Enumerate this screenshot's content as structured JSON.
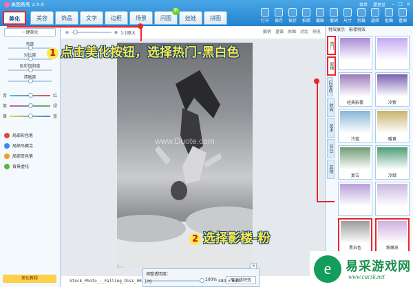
{
  "app": {
    "title": "美图秀秀 2.5.5"
  },
  "tabs": [
    {
      "label": "美化",
      "active": true
    },
    {
      "label": "美容"
    },
    {
      "label": "饰品"
    },
    {
      "label": "文字"
    },
    {
      "label": "边框"
    },
    {
      "label": "场景"
    },
    {
      "label": "闪图",
      "badge": "新"
    },
    {
      "label": "娃娃"
    },
    {
      "label": "拼图"
    }
  ],
  "menu_links": [
    "菜单",
    "提意见"
  ],
  "toolbar": [
    "打开",
    "保存",
    "保存",
    "拍照",
    "截图",
    "撤销",
    "尺寸",
    "剪裁",
    "旋转",
    "抠图",
    "看图"
  ],
  "left_panel": {
    "onekey": "一键美化",
    "adjust": [
      {
        "label": "亮度",
        "value": 0.5
      },
      {
        "label": "对比度",
        "value": 0.5
      },
      {
        "label": "色彩饱和度",
        "value": 0.5
      },
      {
        "label": "清晰度",
        "value": 0.5
      }
    ],
    "color_balance": [
      {
        "left": "青",
        "right": "红",
        "value": 0.5
      },
      {
        "left": "紫",
        "right": "绿",
        "value": 0.5
      },
      {
        "left": "黄",
        "right": "蓝",
        "value": 0.5
      }
    ],
    "tools": [
      {
        "label": "局部彩色笔",
        "color": "#e0483a"
      },
      {
        "label": "局部马赛克",
        "color": "#3a8be0"
      },
      {
        "label": "局部变色笔",
        "color": "#f0a020"
      },
      {
        "label": "背景虚化",
        "color": "#58b548"
      }
    ],
    "tutorial": "美化教程"
  },
  "center": {
    "zoom_label": "1:1原大",
    "edit_buttons": [
      "撤销",
      "重做",
      "原图",
      "对比",
      "预览"
    ],
    "watermark": "www.Duote.com",
    "opacity": {
      "label": "调整透明度：",
      "value": "100%",
      "percent": 100,
      "cancel": "取消该特效"
    },
    "status": {
      "file": "Stock_Photo_-_Falling_Diss_00.jpg",
      "dims": "480 × 640"
    }
  },
  "right_panel": {
    "tabs": [
      "特效展示",
      "影楼特效"
    ],
    "side_tabs": [
      "热门",
      "影楼",
      "LOMO",
      "时尚",
      "艺术",
      "节日",
      "其他"
    ],
    "effects": [
      {
        "name": "",
        "color": "#a88bd8"
      },
      {
        "name": "",
        "color": "#c3a8f0"
      },
      {
        "name": "经典影楼",
        "color": "#9d7bb9"
      },
      {
        "name": "冷紫",
        "color": "#7a62b0"
      },
      {
        "name": "冷蓝",
        "color": "#87b6d6"
      },
      {
        "name": "暖黄",
        "color": "#c7b36a"
      },
      {
        "name": "复古",
        "color": "#6f9c74"
      },
      {
        "name": "冷绿",
        "color": "#4d9c76"
      },
      {
        "name": "",
        "color": "#b8a0d8"
      },
      {
        "name": "",
        "color": "#c8b6e0"
      },
      {
        "name": "黑白色",
        "color": "#9b9b9b",
        "selected": true
      },
      {
        "name": "粉嫩系",
        "color": "#d0b0e0",
        "selected": true
      }
    ]
  },
  "annotations": {
    "step1_num": "1",
    "step1": "点击美化按钮，选择热门-黑白色",
    "step2_num": "2",
    "step2": "选择影楼-粉"
  },
  "corner": {
    "mark": "e",
    "name": "易采游戏网",
    "url": "www.cacsk.net"
  }
}
